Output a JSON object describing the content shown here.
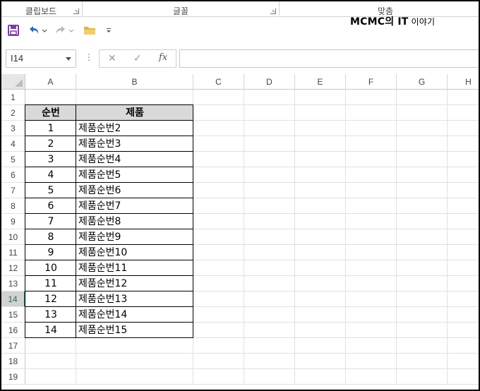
{
  "ribbon": {
    "groups": [
      "클립보드",
      "글꼴",
      "맞춤"
    ]
  },
  "watermark": {
    "brand": "MCMC의 IT",
    "suffix": " 이야기"
  },
  "toolbar": {
    "save_icon": "save-icon",
    "undo_icon": "undo-icon",
    "redo_icon": "redo-icon",
    "open_icon": "folder-icon",
    "customize_icon": "customize-qat-icon"
  },
  "formula_bar": {
    "name_box": "I14",
    "cancel": "✕",
    "enter": "✓",
    "fx": "fx",
    "value": ""
  },
  "sheet": {
    "columns": [
      "A",
      "B",
      "C",
      "D",
      "E",
      "F",
      "G",
      "H"
    ],
    "rows": [
      "1",
      "2",
      "3",
      "4",
      "5",
      "6",
      "7",
      "8",
      "9",
      "10",
      "11",
      "12",
      "13",
      "14",
      "15",
      "16",
      "17",
      "18",
      "19"
    ],
    "active_row": "14",
    "table_header": [
      "순번",
      "제품"
    ],
    "table_rows": [
      [
        "1",
        "제품순번2"
      ],
      [
        "2",
        "제품순번3"
      ],
      [
        "3",
        "제품순번4"
      ],
      [
        "4",
        "제품순번5"
      ],
      [
        "5",
        "제품순번6"
      ],
      [
        "6",
        "제품순번7"
      ],
      [
        "7",
        "제품순번8"
      ],
      [
        "8",
        "제품순번9"
      ],
      [
        "9",
        "제품순번10"
      ],
      [
        "10",
        "제품순번11"
      ],
      [
        "11",
        "제품순번12"
      ],
      [
        "12",
        "제품순번13"
      ],
      [
        "13",
        "제품순번14"
      ],
      [
        "14",
        "제품순번15"
      ]
    ]
  },
  "colors": {
    "header_fill": "#d9d9d9",
    "accent": "#217346",
    "save_icon": "#7b3f9c",
    "undo_icon": "#2b6cb0",
    "folder_icon": "#e0b34a"
  }
}
